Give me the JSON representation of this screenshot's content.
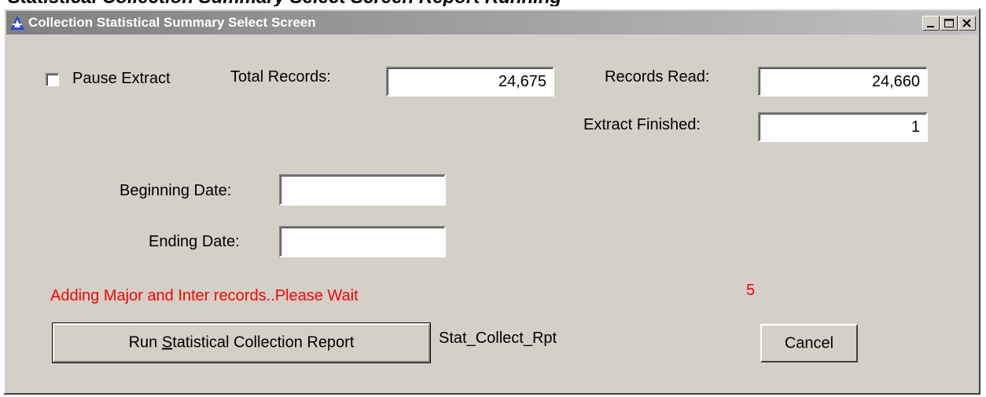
{
  "document_heading": "Statistical Collection Summary Select Screen Report Running",
  "window": {
    "title": "Collection Statistical Summary Select Screen",
    "controls": [
      "minimize-icon",
      "maximize-icon",
      "close-icon"
    ]
  },
  "extract": {
    "pause_label": "Pause Extract",
    "pause_checked": false,
    "total_records_label": "Total Records:",
    "total_records_value": "24,675",
    "records_read_label": "Records Read:",
    "records_read_value": "24,660",
    "extract_finished_label": "Extract Finished:",
    "extract_finished_value": "1"
  },
  "dates": {
    "beginning_label": "Beginning Date:",
    "beginning_value": "",
    "ending_label": "Ending Date:",
    "ending_value": ""
  },
  "status": {
    "message": "Adding Major and Inter records..Please Wait",
    "counter": "5",
    "color": "#ff0000"
  },
  "actions": {
    "run_label_prefix": "Run ",
    "run_label_mnemonic": "S",
    "run_label_suffix": "tatistical Collection Report",
    "report_name": "Stat_Collect_Rpt",
    "cancel_label": "Cancel"
  }
}
